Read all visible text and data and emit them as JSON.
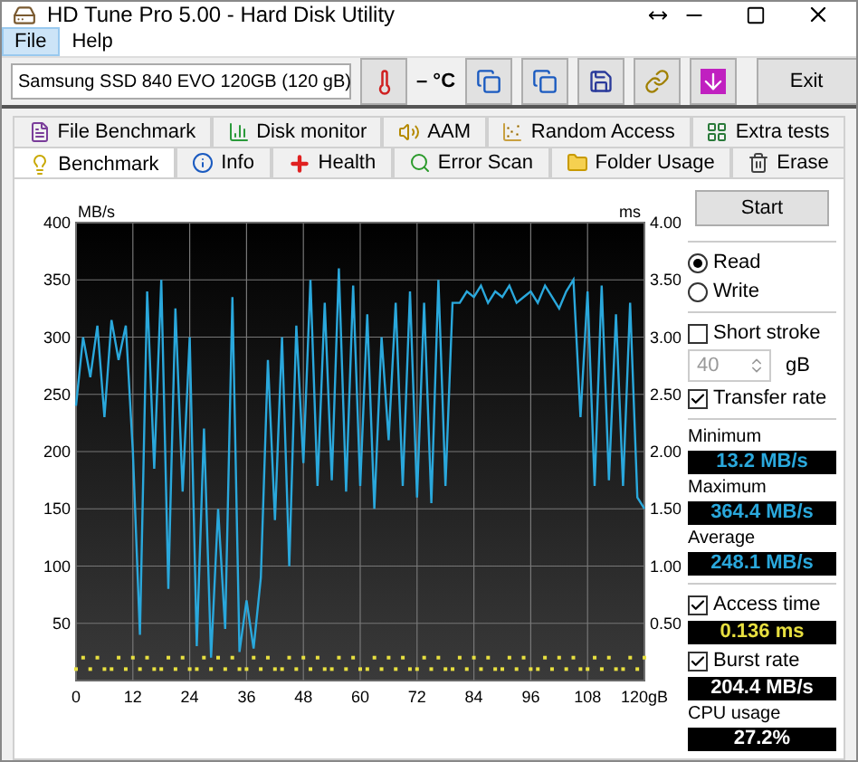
{
  "window": {
    "title": "HD Tune Pro 5.00 - Hard Disk Utility"
  },
  "menu": [
    {
      "label": "File",
      "selected": true
    },
    {
      "label": "Help",
      "selected": false
    }
  ],
  "toolbar": {
    "drive": "Samsung SSD 840 EVO 120GB (120 gB)",
    "temperature": "– °C",
    "tools": [
      {
        "kind": "copy"
      },
      {
        "kind": "copy"
      },
      {
        "kind": "save"
      },
      {
        "kind": "link"
      },
      {
        "kind": "download"
      }
    ],
    "exit": "Exit"
  },
  "tab_rows": [
    [
      {
        "label": "File Benchmark",
        "kind": "file",
        "selected": false
      },
      {
        "label": "Disk monitor",
        "kind": "monitor",
        "selected": false
      },
      {
        "label": "AAM",
        "kind": "speaker",
        "selected": false
      },
      {
        "label": "Random Access",
        "kind": "scatter",
        "selected": false
      },
      {
        "label": "Extra tests",
        "kind": "grid",
        "selected": false
      }
    ],
    [
      {
        "label": "Benchmark",
        "kind": "bulb",
        "selected": true
      },
      {
        "label": "Info",
        "kind": "info",
        "selected": false
      },
      {
        "label": "Health",
        "kind": "cross",
        "selected": false
      },
      {
        "label": "Error Scan",
        "kind": "search",
        "selected": false
      },
      {
        "label": "Folder Usage",
        "kind": "folder",
        "selected": false
      },
      {
        "label": "Erase",
        "kind": "trash",
        "selected": false
      }
    ]
  ],
  "chart_data": {
    "type": "line",
    "ylabel": "MB/s",
    "y2label": "ms",
    "grid": true,
    "xlim": [
      0,
      120
    ],
    "ylim": [
      0,
      400
    ],
    "y2lim": [
      0,
      4
    ],
    "x": [
      0,
      1.5,
      3,
      4.5,
      6,
      7.5,
      9,
      10.5,
      12,
      13.5,
      15,
      16.5,
      18,
      19.5,
      21,
      22.5,
      24,
      25.5,
      27,
      28.5,
      30,
      31.5,
      33,
      34.5,
      36,
      37.5,
      39,
      40.5,
      42,
      43.5,
      45,
      46.5,
      48,
      49.5,
      51,
      52.5,
      54,
      55.5,
      57,
      58.5,
      60,
      61.5,
      63,
      64.5,
      66,
      67.5,
      69,
      70.5,
      72,
      73.5,
      75,
      76.5,
      78,
      79.5,
      81,
      82.5,
      84,
      85.5,
      87,
      88.5,
      90,
      91.5,
      93,
      94.5,
      96,
      97.5,
      99,
      100.5,
      102,
      103.5,
      105,
      106.5,
      108,
      109.5,
      111,
      112.5,
      114,
      115.5,
      117,
      118.5,
      120
    ],
    "xticks": [
      0,
      12,
      24,
      36,
      48,
      60,
      72,
      84,
      96,
      108,
      {
        "value": 120,
        "label": "120gB"
      }
    ],
    "yticks": [
      50,
      100,
      150,
      200,
      250,
      300,
      350,
      400
    ],
    "y2ticks": [
      {
        "value": 0.5,
        "label": "0.50"
      },
      {
        "value": 1,
        "label": "1.00"
      },
      {
        "value": 1.5,
        "label": "1.50"
      },
      {
        "value": 2,
        "label": "2.00"
      },
      {
        "value": 2.5,
        "label": "2.50"
      },
      {
        "value": 3,
        "label": "3.00"
      },
      {
        "value": 3.5,
        "label": "3.50"
      },
      {
        "value": 4,
        "label": "4.00"
      }
    ],
    "series": [
      {
        "color": "#2aa8dc",
        "values": [
          240,
          300,
          265,
          310,
          230,
          315,
          280,
          310,
          200,
          40,
          340,
          185,
          350,
          80,
          325,
          165,
          300,
          30,
          220,
          20,
          150,
          45,
          335,
          25,
          70,
          28,
          90,
          280,
          140,
          300,
          100,
          310,
          190,
          350,
          170,
          330,
          175,
          360,
          165,
          345,
          170,
          320,
          150,
          300,
          210,
          330,
          170,
          340,
          160,
          330,
          155,
          350,
          170,
          330,
          330,
          340,
          335,
          345,
          330,
          340,
          335,
          345,
          330,
          335,
          340,
          330,
          345,
          335,
          325,
          340,
          350,
          230,
          340,
          170,
          345,
          175,
          320,
          170,
          330,
          160,
          150
        ]
      },
      {
        "type": "scatter",
        "axis": "y2",
        "color": "#e8e040",
        "values": [
          0.1,
          0.2,
          0.1,
          0.2,
          0.1,
          0.1,
          0.2,
          0.1,
          0.2,
          0.1,
          0.2,
          0.1,
          0.1,
          0.2,
          0.1,
          0.2,
          0.1,
          0.1,
          0.2,
          0.1,
          0.2,
          0.1,
          0.2,
          0.1,
          0.1,
          0.2,
          0.1,
          0.2,
          0.1,
          0.1,
          0.2,
          0.1,
          0.2,
          0.1,
          0.2,
          0.1,
          0.1,
          0.2,
          0.1,
          0.2,
          0.1,
          0.1,
          0.2,
          0.1,
          0.2,
          0.1,
          0.2,
          0.1,
          0.1,
          0.2,
          0.1,
          0.2,
          0.1,
          0.1,
          0.2,
          0.1,
          0.2,
          0.1,
          0.2,
          0.1,
          0.1,
          0.2,
          0.1,
          0.2,
          0.1,
          0.1,
          0.2,
          0.1,
          0.2,
          0.1,
          0.2,
          0.1,
          0.1,
          0.2,
          0.1,
          0.2,
          0.1,
          0.1,
          0.2,
          0.1,
          0.2
        ]
      }
    ]
  },
  "panel": {
    "start": "Start",
    "modes": [
      {
        "label": "Read",
        "selected": true
      },
      {
        "label": "Write",
        "selected": false
      }
    ],
    "short_stroke": {
      "label": "Short stroke",
      "checked": false
    },
    "stroke_size": {
      "value": "40",
      "disabled": true,
      "unit": "gB"
    },
    "transfer": {
      "label": "Transfer rate",
      "checked": true
    },
    "transfer_readings": [
      {
        "label": "Minimum",
        "value": "13.2 MB/s"
      },
      {
        "label": "Maximum",
        "value": "364.4 MB/s"
      },
      {
        "label": "Average",
        "value": "248.1 MB/s"
      }
    ],
    "access": {
      "label": "Access time",
      "checked": true,
      "value": "0.136 ms"
    },
    "burst": {
      "label": "Burst rate",
      "checked": true,
      "value": "204.4 MB/s"
    },
    "cpu": {
      "label": "CPU usage",
      "value": "27.2%"
    }
  }
}
